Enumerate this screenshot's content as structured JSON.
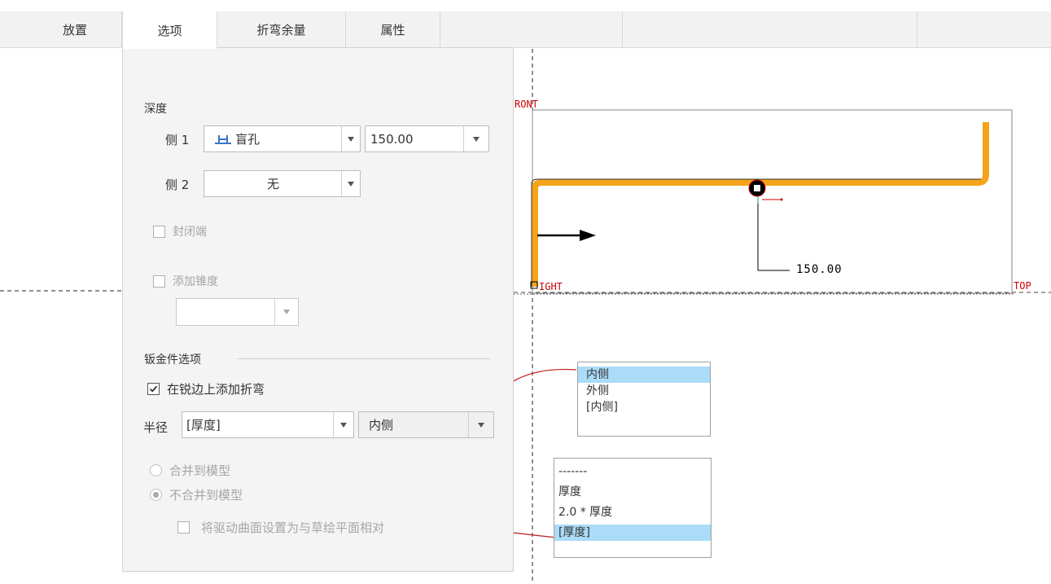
{
  "tabs": [
    {
      "label": "放置"
    },
    {
      "label": "选项"
    },
    {
      "label": "折弯余量"
    },
    {
      "label": "属性"
    }
  ],
  "options_panel": {
    "depth_title": "深度",
    "side1": {
      "label": "侧 1",
      "type_value": "盲孔",
      "depth_value": "150.00"
    },
    "side2": {
      "label": "侧 2",
      "type_value": "无"
    },
    "capped_ends": {
      "label": "封闭端",
      "checked": false,
      "enabled": false
    },
    "add_taper": {
      "label": "添加锥度",
      "checked": false,
      "enabled": false,
      "value": ""
    },
    "sheetmetal_title": "钣金件选项",
    "add_bends": {
      "label": "在锐边上添加折弯",
      "checked": true
    },
    "radius": {
      "label": "半径",
      "value": "[厚度]",
      "side_value": "内侧"
    },
    "merge_to_model": {
      "label": "合并到模型",
      "selected": false,
      "enabled": false
    },
    "no_merge_to_model": {
      "label": "不合并到模型",
      "selected": true,
      "enabled": false
    },
    "drive_surface": {
      "label": "将驱动曲面设置为与草绘平面相对",
      "checked": false,
      "enabled": false
    }
  },
  "viewport": {
    "label_front": "RONT",
    "label_right": "IGHT",
    "label_top": "TOP",
    "dimension_value": "150.00",
    "sketch_color": "#f5a31a",
    "datum_color": "#cc0000"
  },
  "side_dropdown": {
    "options": [
      "内侧",
      "外侧",
      "[内侧]"
    ],
    "selected_index": 0
  },
  "radius_dropdown": {
    "options": [
      "-------",
      "厚度",
      "2.0 * 厚度",
      "[厚度]"
    ],
    "selected_index": 3
  },
  "colors": {
    "selection_highlight": "#aadcf7",
    "annotation_arrow": "#c62828"
  }
}
